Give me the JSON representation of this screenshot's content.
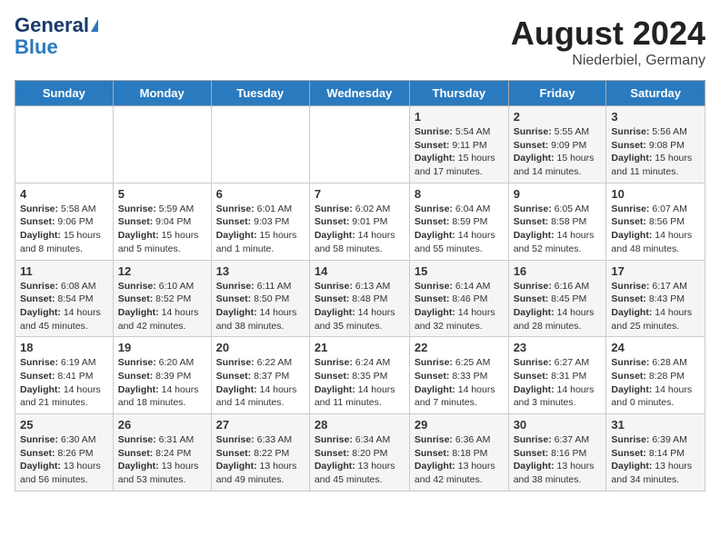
{
  "header": {
    "logo_line1": "General",
    "logo_line2": "Blue",
    "month_title": "August 2024",
    "location": "Niederbiel, Germany"
  },
  "days_of_week": [
    "Sunday",
    "Monday",
    "Tuesday",
    "Wednesday",
    "Thursday",
    "Friday",
    "Saturday"
  ],
  "weeks": [
    [
      {
        "day": "",
        "content": ""
      },
      {
        "day": "",
        "content": ""
      },
      {
        "day": "",
        "content": ""
      },
      {
        "day": "",
        "content": ""
      },
      {
        "day": "1",
        "content": "Sunrise: 5:54 AM\nSunset: 9:11 PM\nDaylight: 15 hours and 17 minutes."
      },
      {
        "day": "2",
        "content": "Sunrise: 5:55 AM\nSunset: 9:09 PM\nDaylight: 15 hours and 14 minutes."
      },
      {
        "day": "3",
        "content": "Sunrise: 5:56 AM\nSunset: 9:08 PM\nDaylight: 15 hours and 11 minutes."
      }
    ],
    [
      {
        "day": "4",
        "content": "Sunrise: 5:58 AM\nSunset: 9:06 PM\nDaylight: 15 hours and 8 minutes."
      },
      {
        "day": "5",
        "content": "Sunrise: 5:59 AM\nSunset: 9:04 PM\nDaylight: 15 hours and 5 minutes."
      },
      {
        "day": "6",
        "content": "Sunrise: 6:01 AM\nSunset: 9:03 PM\nDaylight: 15 hours and 1 minute."
      },
      {
        "day": "7",
        "content": "Sunrise: 6:02 AM\nSunset: 9:01 PM\nDaylight: 14 hours and 58 minutes."
      },
      {
        "day": "8",
        "content": "Sunrise: 6:04 AM\nSunset: 8:59 PM\nDaylight: 14 hours and 55 minutes."
      },
      {
        "day": "9",
        "content": "Sunrise: 6:05 AM\nSunset: 8:58 PM\nDaylight: 14 hours and 52 minutes."
      },
      {
        "day": "10",
        "content": "Sunrise: 6:07 AM\nSunset: 8:56 PM\nDaylight: 14 hours and 48 minutes."
      }
    ],
    [
      {
        "day": "11",
        "content": "Sunrise: 6:08 AM\nSunset: 8:54 PM\nDaylight: 14 hours and 45 minutes."
      },
      {
        "day": "12",
        "content": "Sunrise: 6:10 AM\nSunset: 8:52 PM\nDaylight: 14 hours and 42 minutes."
      },
      {
        "day": "13",
        "content": "Sunrise: 6:11 AM\nSunset: 8:50 PM\nDaylight: 14 hours and 38 minutes."
      },
      {
        "day": "14",
        "content": "Sunrise: 6:13 AM\nSunset: 8:48 PM\nDaylight: 14 hours and 35 minutes."
      },
      {
        "day": "15",
        "content": "Sunrise: 6:14 AM\nSunset: 8:46 PM\nDaylight: 14 hours and 32 minutes."
      },
      {
        "day": "16",
        "content": "Sunrise: 6:16 AM\nSunset: 8:45 PM\nDaylight: 14 hours and 28 minutes."
      },
      {
        "day": "17",
        "content": "Sunrise: 6:17 AM\nSunset: 8:43 PM\nDaylight: 14 hours and 25 minutes."
      }
    ],
    [
      {
        "day": "18",
        "content": "Sunrise: 6:19 AM\nSunset: 8:41 PM\nDaylight: 14 hours and 21 minutes."
      },
      {
        "day": "19",
        "content": "Sunrise: 6:20 AM\nSunset: 8:39 PM\nDaylight: 14 hours and 18 minutes."
      },
      {
        "day": "20",
        "content": "Sunrise: 6:22 AM\nSunset: 8:37 PM\nDaylight: 14 hours and 14 minutes."
      },
      {
        "day": "21",
        "content": "Sunrise: 6:24 AM\nSunset: 8:35 PM\nDaylight: 14 hours and 11 minutes."
      },
      {
        "day": "22",
        "content": "Sunrise: 6:25 AM\nSunset: 8:33 PM\nDaylight: 14 hours and 7 minutes."
      },
      {
        "day": "23",
        "content": "Sunrise: 6:27 AM\nSunset: 8:31 PM\nDaylight: 14 hours and 3 minutes."
      },
      {
        "day": "24",
        "content": "Sunrise: 6:28 AM\nSunset: 8:28 PM\nDaylight: 14 hours and 0 minutes."
      }
    ],
    [
      {
        "day": "25",
        "content": "Sunrise: 6:30 AM\nSunset: 8:26 PM\nDaylight: 13 hours and 56 minutes."
      },
      {
        "day": "26",
        "content": "Sunrise: 6:31 AM\nSunset: 8:24 PM\nDaylight: 13 hours and 53 minutes."
      },
      {
        "day": "27",
        "content": "Sunrise: 6:33 AM\nSunset: 8:22 PM\nDaylight: 13 hours and 49 minutes."
      },
      {
        "day": "28",
        "content": "Sunrise: 6:34 AM\nSunset: 8:20 PM\nDaylight: 13 hours and 45 minutes."
      },
      {
        "day": "29",
        "content": "Sunrise: 6:36 AM\nSunset: 8:18 PM\nDaylight: 13 hours and 42 minutes."
      },
      {
        "day": "30",
        "content": "Sunrise: 6:37 AM\nSunset: 8:16 PM\nDaylight: 13 hours and 38 minutes."
      },
      {
        "day": "31",
        "content": "Sunrise: 6:39 AM\nSunset: 8:14 PM\nDaylight: 13 hours and 34 minutes."
      }
    ]
  ]
}
